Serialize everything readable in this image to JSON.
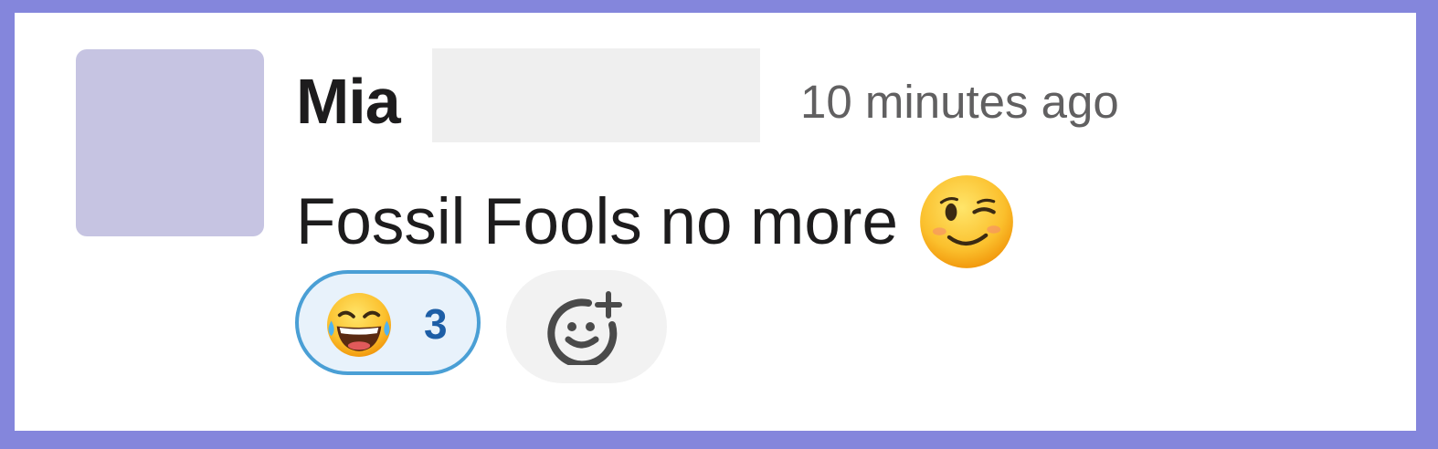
{
  "message": {
    "author": "Mia",
    "timestamp": "10 minutes ago",
    "text": "Fossil Fools no more",
    "inline_emoji": "winking-face-emoji"
  },
  "reactions": [
    {
      "emoji": "face-with-tears-of-joy-emoji",
      "count": "3",
      "selected": true
    }
  ],
  "add_reaction": {
    "icon": "add-reaction-icon"
  },
  "colors": {
    "frame_border": "#8486DC",
    "avatar": "#C6C4E2",
    "reaction_border": "#4A9FD5",
    "reaction_count": "#1D5EA6"
  }
}
